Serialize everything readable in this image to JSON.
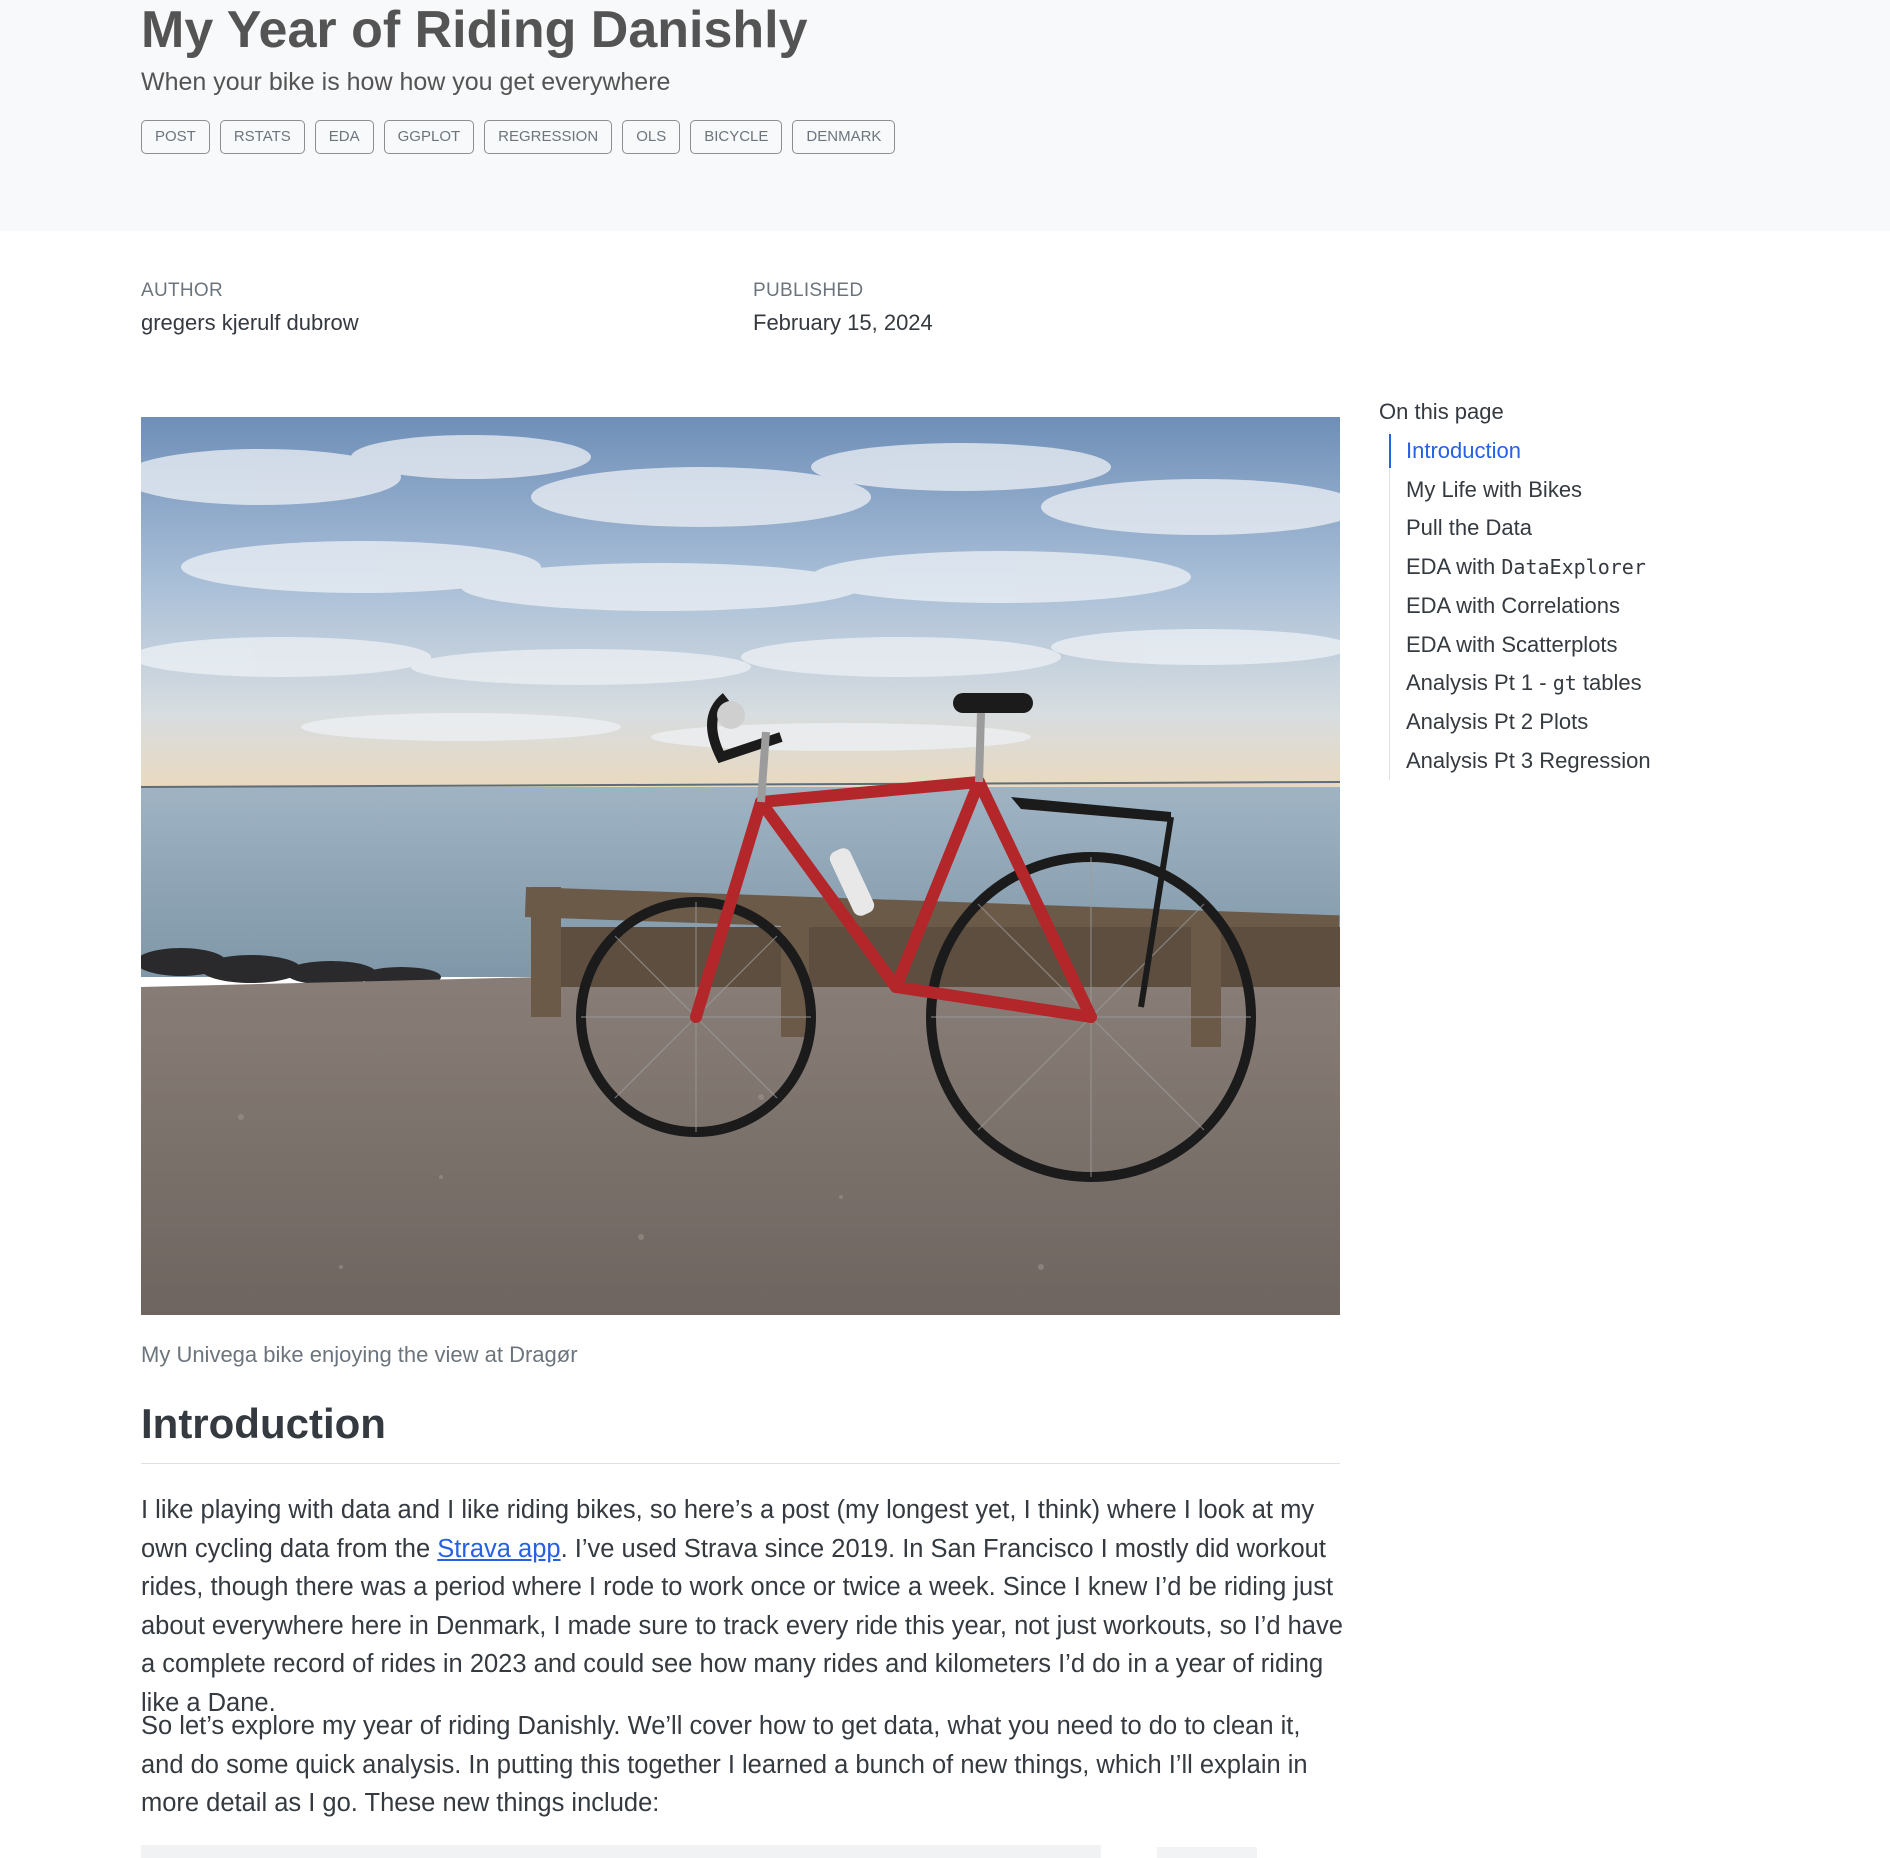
{
  "header": {
    "title": "My Year of Riding Danishly",
    "subtitle": "When your bike is how how you get everywhere",
    "tags": [
      "POST",
      "RSTATS",
      "EDA",
      "GGPLOT",
      "REGRESSION",
      "OLS",
      "BICYCLE",
      "DENMARK"
    ]
  },
  "meta": {
    "author_label": "AUTHOR",
    "author": "gregers kjerulf dubrow",
    "published_label": "PUBLISHED",
    "published": "February 15, 2024"
  },
  "hero": {
    "caption": "My Univega bike enjoying the view at Dragør"
  },
  "toc": {
    "title": "On this page",
    "items": [
      {
        "label": "Introduction",
        "active": true
      },
      {
        "label": "My Life with Bikes"
      },
      {
        "label": "Pull the Data"
      },
      {
        "label": "EDA with ",
        "code": "DataExplorer"
      },
      {
        "label": "EDA with Correlations"
      },
      {
        "label": "EDA with Scatterplots"
      },
      {
        "label": "Analysis Pt 1 - ",
        "code": "gt",
        "suffix": " tables"
      },
      {
        "label": "Analysis Pt 2 Plots"
      },
      {
        "label": "Analysis Pt 3 Regression"
      }
    ]
  },
  "content": {
    "heading": "Introduction",
    "para1_before": "I like playing with data and I like riding bikes, so here’s a post (my longest yet, I think) where I look at my own cycling data from the ",
    "para1_link": "Strava app",
    "para1_after": ". I’ve used Strava since 2019. In San Francisco I mostly did workout rides, though there was a period where I rode to work once or twice a week. Since I knew I’d be riding just about everywhere here in Denmark, I made sure to track every ride this year, not just workouts, so I’d have a complete record of rides in 2023 and could see how many rides and kilometers I’d do in a year of riding like a Dane.",
    "para2": "So let’s explore my year of riding Danishly. We’ll cover how to get data, what you need to do to clean it, and do some quick analysis. In putting this together I learned a bunch of new things, which I’ll explain in more detail as I go. These new things include:"
  },
  "colors": {
    "link": "#2761e3",
    "banner_bg": "#f8f9fa",
    "text": "#343a40",
    "muted": "#6c757d"
  }
}
